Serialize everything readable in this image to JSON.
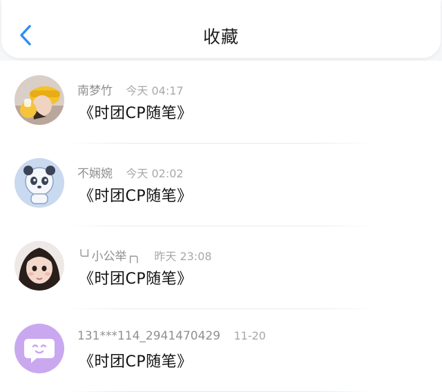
{
  "header": {
    "title": "收藏",
    "back_icon": "chevron-left-icon",
    "accent": "#2f8df6"
  },
  "items": [
    {
      "name": "南梦竹",
      "time": "今天 04:17",
      "message": "《时团CP随笔》",
      "avatar": "photo-girl-yellow-hat"
    },
    {
      "name": "不娴婉",
      "time": "今天 02:02",
      "message": "《时团CP随笔》",
      "avatar": "panda-cartoon"
    },
    {
      "name": "╰┘小公举┌╮",
      "time": "昨天 23:08",
      "message": "《时团CP随笔》",
      "avatar": "photo-child-face"
    },
    {
      "name": "131***114_2941470429",
      "time": "11-20",
      "message": "《时团CP随笔》",
      "avatar": "chat-bubble-purple"
    }
  ]
}
